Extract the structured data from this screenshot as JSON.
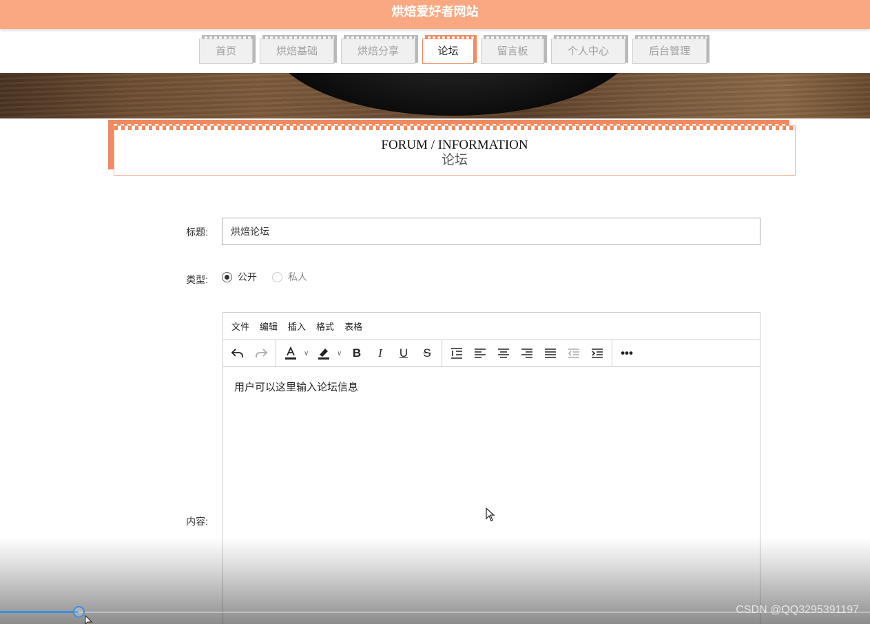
{
  "site": {
    "title": "烘焙爱好者网站"
  },
  "nav": {
    "items": [
      {
        "label": "首页",
        "width": 78,
        "active": false
      },
      {
        "label": "烘焙基础",
        "width": 108,
        "active": false
      },
      {
        "label": "烘焙分享",
        "width": 108,
        "active": false
      },
      {
        "label": "论坛",
        "width": 75,
        "active": true
      },
      {
        "label": "留言板",
        "width": 92,
        "active": false
      },
      {
        "label": "个人中心",
        "width": 108,
        "active": false
      },
      {
        "label": "后台管理",
        "width": 108,
        "active": false
      }
    ]
  },
  "section": {
    "title_en": "FORUM / INFORMATION",
    "title_cn": "论坛"
  },
  "form": {
    "title_label": "标题:",
    "title_value": "烘焙论坛",
    "type_label": "类型:",
    "type_options": [
      {
        "label": "公开",
        "checked": true
      },
      {
        "label": "私人",
        "checked": false
      }
    ],
    "content_label": "内容:"
  },
  "editor": {
    "menu": [
      "文件",
      "编辑",
      "插入",
      "格式",
      "表格"
    ],
    "content": "用户可以这里输入论坛信息"
  },
  "video": {
    "progress_percent": 9
  },
  "watermark": "CSDN @QQ3295391197",
  "colors": {
    "accent": "#f9a882",
    "accent_dark": "#f08a60",
    "progress": "#3d8fe0"
  }
}
